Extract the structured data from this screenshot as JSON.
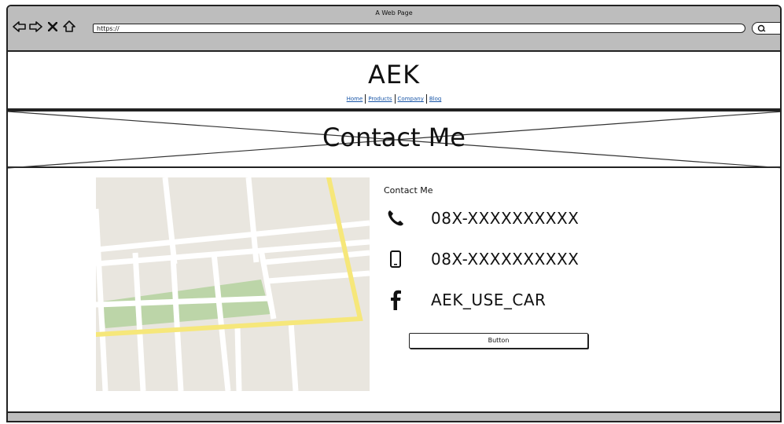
{
  "browser": {
    "title": "A Web Page",
    "url": "https://"
  },
  "site": {
    "logo": "AEK",
    "nav": [
      "Home",
      "Products",
      "Company",
      "Blog"
    ]
  },
  "banner": {
    "title": "Contact Me"
  },
  "contact": {
    "heading": "Contact Me",
    "phone": "08X-XXXXXXXXXX",
    "mobile": "08X-XXXXXXXXXX",
    "facebook": "AEK_USE_CAR",
    "button_label": "Button"
  },
  "icons": {
    "back": "back-arrow-icon",
    "forward": "forward-arrow-icon",
    "stop": "close-icon",
    "home": "home-icon",
    "search": "search-icon",
    "phone": "phone-icon",
    "mobile": "mobile-icon",
    "facebook": "facebook-icon"
  },
  "colors": {
    "chrome": "#bdbdbd",
    "link": "#1a57a8",
    "map_bg": "#e9e6df",
    "map_road_major": "#f6e77a",
    "map_park": "#bcd5a8"
  }
}
